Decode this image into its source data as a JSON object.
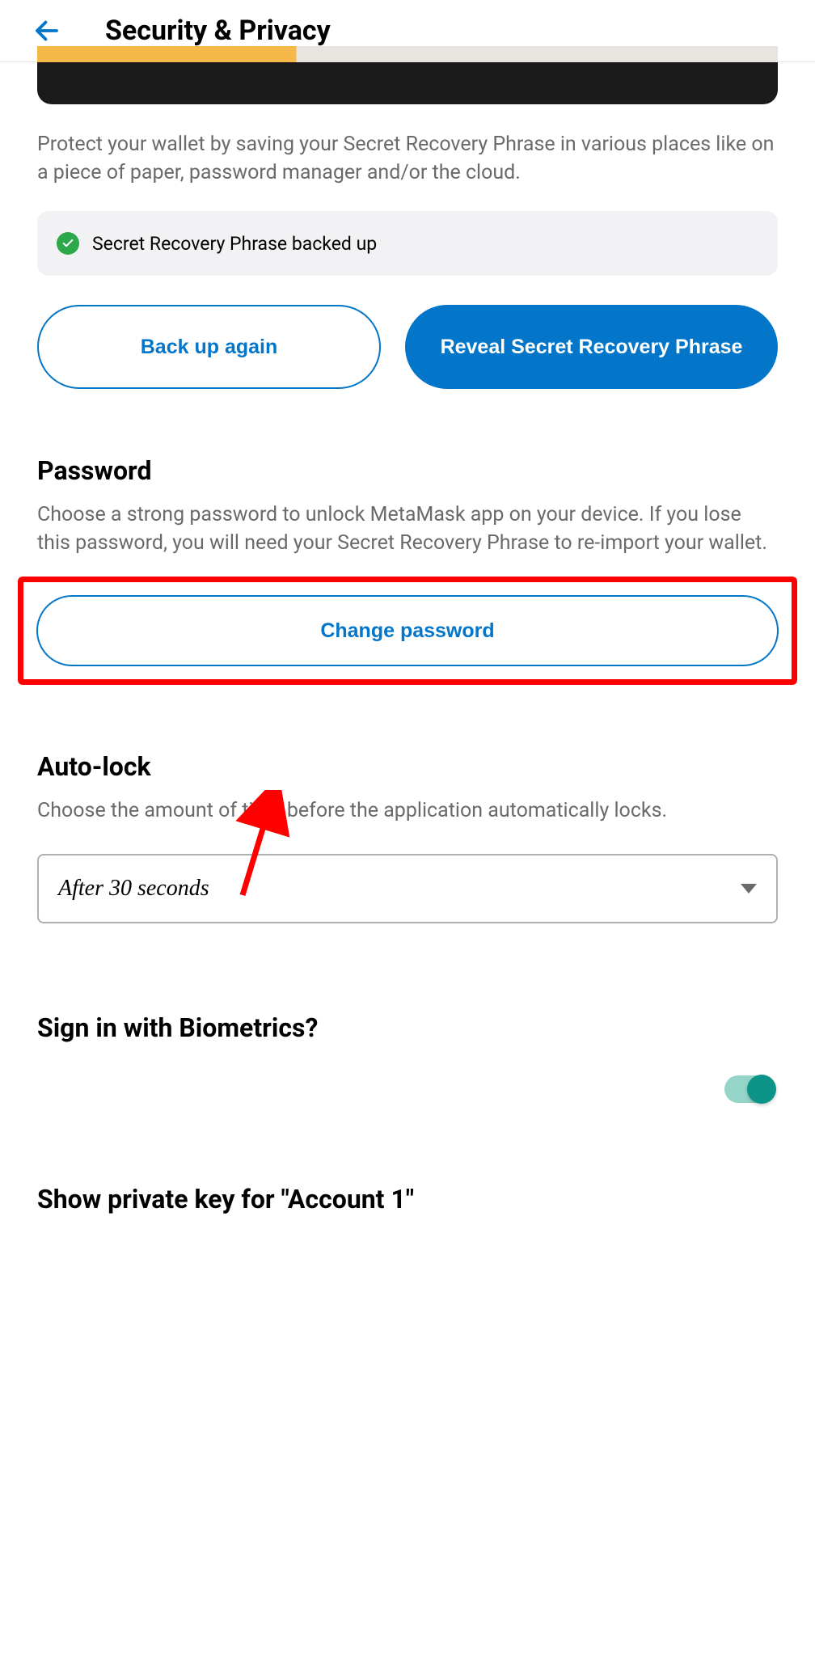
{
  "header": {
    "title": "Security & Privacy"
  },
  "recovery_phrase": {
    "description": "Protect your wallet by saving your Secret Recovery Phrase in various places like on a piece of paper, password manager and/or the cloud.",
    "status_text": "Secret Recovery Phrase backed up",
    "backup_button": "Back up again",
    "reveal_button": "Reveal Secret Recovery Phrase"
  },
  "password": {
    "title": "Password",
    "description": "Choose a strong password to unlock MetaMask app on your device. If you lose this password, you will need your Secret Recovery Phrase to re-import your wallet.",
    "change_button": "Change password"
  },
  "autolock": {
    "title": "Auto-lock",
    "description": "Choose the amount of time before the application automatically locks.",
    "selected_value": "After 30 seconds"
  },
  "biometrics": {
    "title": "Sign in with Biometrics?",
    "enabled": true
  },
  "private_key": {
    "title": "Show private key for \"Account 1\""
  },
  "colors": {
    "primary": "#0376c9",
    "success": "#2ba84a",
    "highlight": "#ff0000",
    "toggle": "#0d9488"
  }
}
